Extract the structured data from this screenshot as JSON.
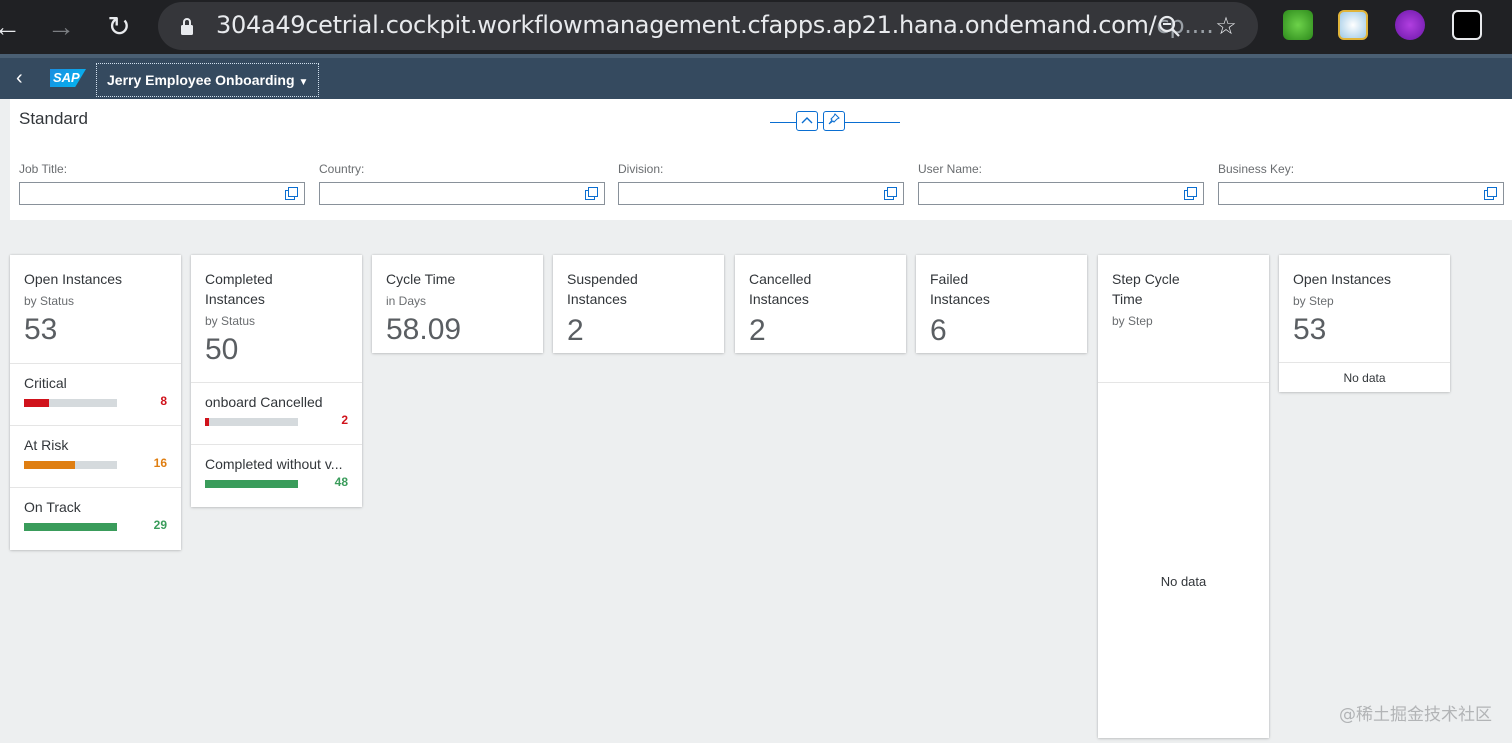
{
  "browser": {
    "url_main": "304a49cetrial.cockpit.workflowmanagement.cfapps.ap21.hana.ondemand.com/",
    "url_rest": "cp...."
  },
  "shell": {
    "logo_text": "SAP",
    "app_title": "Jerry Employee Onboarding"
  },
  "filterbar": {
    "variant": "Standard",
    "filters": [
      {
        "label": "Job Title:",
        "value": ""
      },
      {
        "label": "Country:",
        "value": ""
      },
      {
        "label": "Division:",
        "value": ""
      },
      {
        "label": "User Name:",
        "value": ""
      },
      {
        "label": "Business Key:",
        "value": ""
      }
    ]
  },
  "colors": {
    "critical": "#d0121b",
    "at_risk": "#df7e11",
    "on_track": "#3a9c5b",
    "shell": "#354a5f",
    "accent": "#0a6ed1"
  },
  "cards": [
    {
      "title": "Open Instances",
      "subtitle": "by Status",
      "kpi": "53",
      "rows": [
        {
          "label": "Critical",
          "value": "8",
          "fraction": 0.27,
          "color": "#d0121b"
        },
        {
          "label": "At Risk",
          "value": "16",
          "fraction": 0.55,
          "color": "#df7e11"
        },
        {
          "label": "On Track",
          "value": "29",
          "fraction": 1.0,
          "color": "#3a9c5b"
        }
      ]
    },
    {
      "title": "Completed Instances",
      "subtitle": "by Status",
      "kpi": "50",
      "rows": [
        {
          "label": "onboard Cancelled",
          "value": "2",
          "fraction": 0.04,
          "color": "#d0121b"
        },
        {
          "label": "Completed without v...",
          "value": "48",
          "fraction": 1.0,
          "color": "#3a9c5b"
        }
      ]
    },
    {
      "title": "Cycle Time",
      "subtitle": "in Days",
      "kpi": "58.09"
    },
    {
      "title": "Suspended Instances",
      "kpi": "2"
    },
    {
      "title": "Cancelled Instances",
      "kpi": "2"
    },
    {
      "title": "Failed Instances",
      "kpi": "6"
    },
    {
      "title": "Step Cycle Time",
      "subtitle": "by Step",
      "nodata": "No data"
    },
    {
      "title": "Open Instances",
      "subtitle": "by Step",
      "kpi": "53",
      "nodata": "No data"
    }
  ],
  "watermark": "@稀土掘金技术社区"
}
